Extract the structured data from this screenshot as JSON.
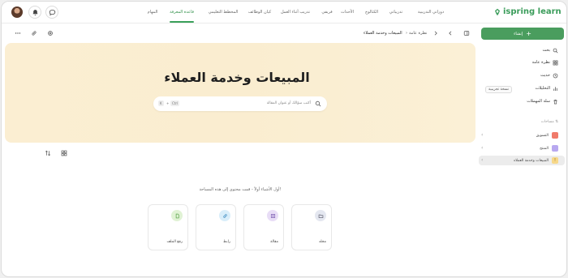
{
  "header": {
    "logo_text": "ispring learn",
    "nav": [
      {
        "label": "دوراتي التدريبية"
      },
      {
        "label": "تدريباتي"
      },
      {
        "label": "الكتالوج"
      },
      {
        "label": "الأحداث"
      },
      {
        "label": "فريقي"
      },
      {
        "label": "تدريب أثناء العمل"
      },
      {
        "label": "كيان الوظائف"
      },
      {
        "label": "المخطط التعليمي"
      },
      {
        "label": "قاعدة المعرفة",
        "active": true
      },
      {
        "label": "المهام"
      }
    ],
    "accent_color": "#3aa05a"
  },
  "toolbar": {
    "breadcrumb": [
      "نظرة عامة",
      "المبيعات وخدمة العملاء"
    ]
  },
  "sidebar": {
    "create_label": "إنشاء",
    "items": [
      {
        "label": "بحث",
        "icon": "search-icon"
      },
      {
        "label": "نظرة عامة",
        "icon": "grid-icon"
      },
      {
        "label": "حديث",
        "icon": "clock-icon"
      },
      {
        "label": "التحليلات",
        "icon": "analytics-icon"
      },
      {
        "label": "سلة المهملات",
        "icon": "trash-icon"
      }
    ],
    "trial_badge": "نسخة تجريبية",
    "spaces_label": "مساحات",
    "spaces": [
      {
        "label": "التسويق",
        "color": "#f07a6a",
        "icon": ""
      },
      {
        "label": "المنتج",
        "color": "#b8a8f0",
        "icon": ""
      },
      {
        "label": "المبيعات وخدمة العملاء",
        "color": "#f7d889",
        "icon": "!"
      }
    ]
  },
  "main": {
    "title": "المبيعات وخدمة العملاء",
    "search_placeholder": "أكتب سؤالك أو عنوان المقالة",
    "shortcut_ctrl": "Ctrl",
    "shortcut_plus": "+",
    "shortcut_key": "K",
    "empty_message": "أول الأشياء أولاً - قمت محتوى إلى هذه المساحة!",
    "cards": [
      {
        "label": "مجلد",
        "color": "#e4e7f0",
        "icon": "folder-icon"
      },
      {
        "label": "مقالة",
        "color": "#e8ddf6",
        "icon": "article-icon"
      },
      {
        "label": "رابط",
        "color": "#d9eefa",
        "icon": "link-icon"
      },
      {
        "label": "رفع الملف",
        "color": "#e0f2d4",
        "icon": "upload-file-icon"
      }
    ]
  }
}
